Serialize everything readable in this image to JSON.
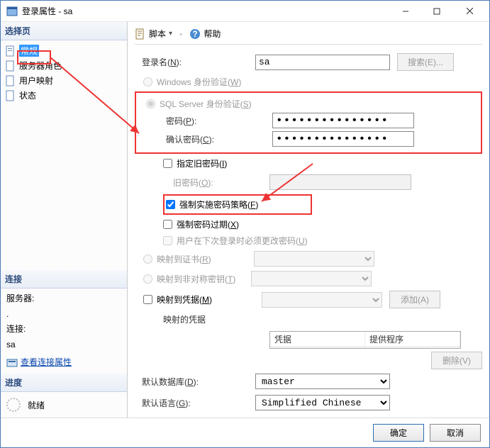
{
  "window": {
    "title": "登录属性 - sa"
  },
  "left": {
    "select_page": "选择页",
    "items": [
      {
        "label": "常规",
        "selected": true
      },
      {
        "label": "服务器角色",
        "selected": false
      },
      {
        "label": "用户映射",
        "selected": false
      },
      {
        "label": "状态",
        "selected": false
      }
    ],
    "conn_header": "连接",
    "server_label": "服务器:",
    "server_value": ".",
    "conn_label": "连接:",
    "conn_value": "sa",
    "view_props": "查看连接属性",
    "progress_header": "进度",
    "ready": "就绪"
  },
  "toolbar": {
    "script": "脚本",
    "help": "帮助"
  },
  "form": {
    "login_name_label": "登录名(N):",
    "login_name_value": "sa",
    "search_btn": "搜索(E)...",
    "win_auth": "Windows 身份验证(W)",
    "sql_auth": "SQL Server 身份验证(S)",
    "password_label": "密码(P):",
    "password_value": "●●●●●●●●●●●●●●●",
    "confirm_label": "确认密码(C):",
    "confirm_value": "●●●●●●●●●●●●●●●",
    "specify_old": "指定旧密码(I)",
    "old_pwd_label": "旧密码(O):",
    "enforce_policy": "强制实施密码策略(F)",
    "enforce_expire": "强制密码过期(X)",
    "must_change": "用户在下次登录时必须更改密码(U)",
    "map_cert": "映射到证书(R)",
    "map_asym": "映射到非对称密钥(T)",
    "map_cred": "映射到凭据(M)",
    "add_btn": "添加(A)",
    "mapped_creds_label": "映射的凭据",
    "col_cred": "凭据",
    "col_prov": "提供程序",
    "remove_btn": "删除(V)",
    "default_db_label": "默认数据库(D):",
    "default_db_value": "master",
    "default_lang_label": "默认语言(G):",
    "default_lang_value": "Simplified Chinese"
  },
  "buttons": {
    "ok": "确定",
    "cancel": "取消"
  }
}
